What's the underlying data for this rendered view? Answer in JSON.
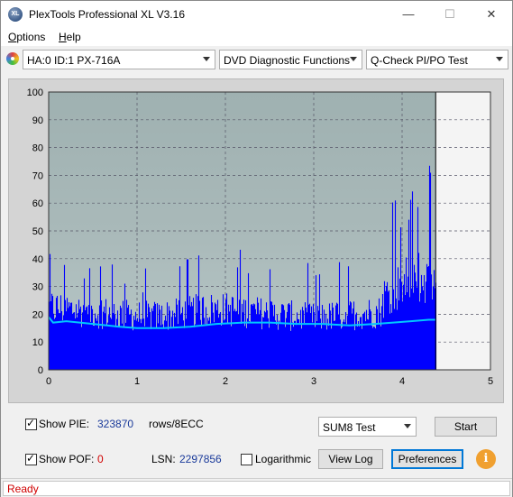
{
  "window": {
    "title": "PlexTools Professional XL V3.16",
    "icon_text": "XL"
  },
  "controls": {
    "minimize": "—",
    "maximize": "☐",
    "close": "✕"
  },
  "menu": {
    "options": {
      "first": "O",
      "rest": "ptions"
    },
    "help": {
      "first": "H",
      "rest": "elp"
    }
  },
  "toolbar": {
    "drive": "HA:0 ID:1  PX-716A",
    "function": "DVD Diagnostic Functions",
    "test": "Q-Check PI/PO Test"
  },
  "chart_data": {
    "type": "bar",
    "title": "",
    "xlabel": "",
    "ylabel": "",
    "xlim": [
      0,
      5
    ],
    "ylim": [
      0,
      100
    ],
    "x_ticks": [
      "0",
      "1",
      "2",
      "3",
      "4",
      "5"
    ],
    "y_ticks": [
      "0",
      "10",
      "20",
      "30",
      "40",
      "50",
      "60",
      "70",
      "80",
      "90",
      "100"
    ],
    "grid": true,
    "scan_end_x": 4.38,
    "colors": {
      "pie_bars": "#0000ff",
      "sum_line": "#00c8ff",
      "plot_bg": "#a9b9b9",
      "unscanned_bg": "#f4f4f4"
    },
    "series": [
      {
        "x": [
          0,
          0.25,
          0.5,
          0.75,
          1.0,
          1.25,
          1.5,
          1.75,
          2.0,
          2.25,
          2.5,
          2.75,
          3.0,
          3.25,
          3.5,
          3.75,
          3.8,
          4.0,
          4.1,
          4.2,
          4.3,
          4.38
        ],
        "values": [
          29,
          28,
          27,
          26,
          25,
          25,
          26,
          28,
          28,
          27,
          26,
          25,
          24,
          25,
          26,
          27,
          35,
          40,
          42,
          44,
          39,
          36
        ]
      },
      {
        "x": [
          0,
          0.05,
          0.2,
          0.5,
          0.8,
          1.0,
          1.3,
          1.6,
          1.9,
          2.2,
          2.5,
          2.8,
          3.1,
          3.4,
          3.7,
          3.9,
          4.1,
          4.3,
          4.38
        ],
        "values": [
          19,
          17,
          17.5,
          16.5,
          15.5,
          15,
          15,
          15.5,
          16.5,
          17,
          17,
          16.5,
          16.5,
          16,
          16.5,
          17,
          17.5,
          18,
          18
        ]
      }
    ]
  },
  "bottom": {
    "show_pie_label": "Show PIE:",
    "pie_value": "323870",
    "pie_unit": "rows/8ECC",
    "show_poe_label": "Show POF:",
    "poe_value": "0",
    "lsn_label": "LSN:",
    "lsn_value": "2297856",
    "logarithmic_label": "Logarithmic",
    "sum_test_select": "SUM8 Test",
    "start_button": "Start",
    "view_log_button": "View Log",
    "preferences_button": "Preferences",
    "info_button": "i"
  },
  "status": {
    "text": "Ready"
  }
}
